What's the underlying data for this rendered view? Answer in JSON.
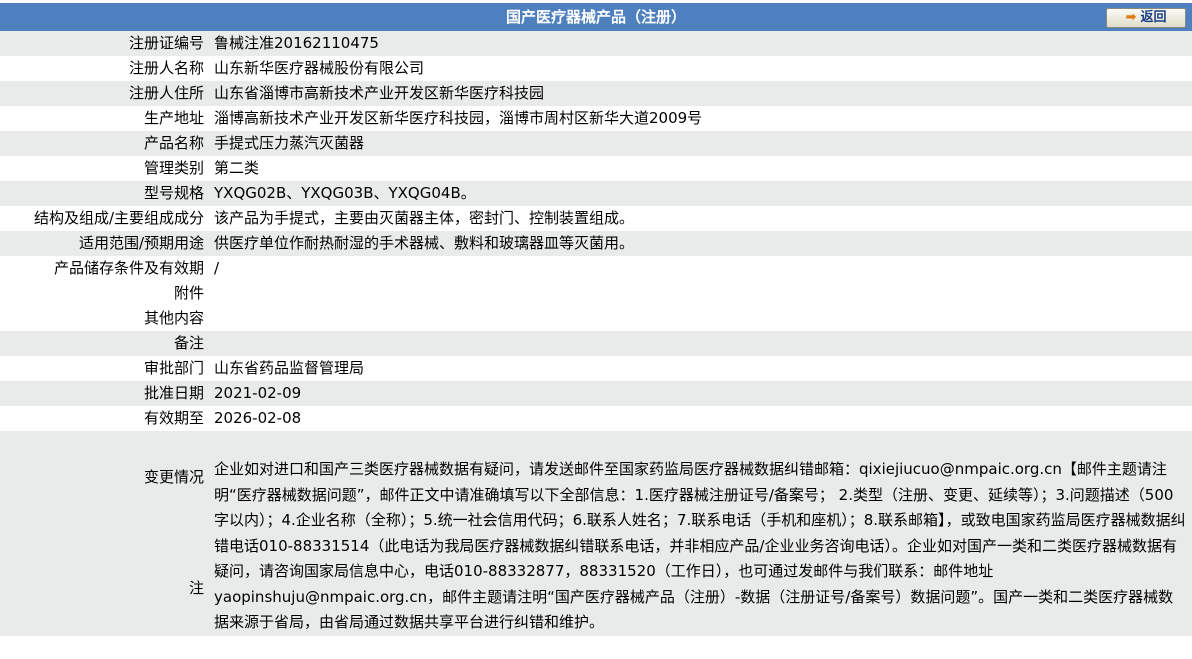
{
  "page": {
    "title": "国产医疗器械产品（注册）",
    "back_button_label": "返回",
    "back_icon": "arrow-right-icon"
  },
  "rows": [
    {
      "label": "注册证编号",
      "value": "鲁械注准20162110475"
    },
    {
      "label": "注册人名称",
      "value": "山东新华医疗器械股份有限公司"
    },
    {
      "label": "注册人住所",
      "value": "山东省淄博市高新技术产业开发区新华医疗科技园"
    },
    {
      "label": "生产地址",
      "value": "淄博高新技术产业开发区新华医疗科技园，淄博市周村区新华大道2009号"
    },
    {
      "label": "产品名称",
      "value": "手提式压力蒸汽灭菌器"
    },
    {
      "label": "管理类别",
      "value": "第二类"
    },
    {
      "label": "型号规格",
      "value": "YXQG02B、YXQG03B、YXQG04B。"
    },
    {
      "label": "结构及组成/主要组成成分",
      "value": "该产品为手提式，主要由灭菌器主体，密封门、控制装置组成。"
    },
    {
      "label": "适用范围/预期用途",
      "value": "供医疗单位作耐热耐湿的手术器械、敷料和玻璃器皿等灭菌用。"
    },
    {
      "label": "产品储存条件及有效期",
      "value": "/"
    },
    {
      "label": "附件",
      "value": ""
    },
    {
      "label": "其他内容",
      "value": ""
    },
    {
      "label": "备注",
      "value": ""
    },
    {
      "label": "审批部门",
      "value": "山东省药品监督管理局"
    },
    {
      "label": "批准日期",
      "value": "2021-02-09"
    },
    {
      "label": "有效期至",
      "value": "2026-02-08"
    },
    {
      "label": "变更情况",
      "value": ""
    }
  ],
  "note": {
    "label": "注",
    "text": "企业如对进口和国产三类医疗器械数据有疑问，请发送邮件至国家药监局医疗器械数据纠错邮箱：qixiejiucuo@nmpaic.org.cn【邮件主题请注明“医疗器械数据问题”，邮件正文中请准确填写以下全部信息：1.医疗器械注册证号/备案号； 2.类型（注册、变更、延续等）；3.问题描述（500字以内）；4.企业名称（全称）；5.统一社会信用代码；6.联系人姓名；7.联系电话（手机和座机）；8.联系邮箱】，或致电国家药监局医疗器械数据纠错电话010-88331514（此电话为我局医疗器械数据纠错联系电话，并非相应产品/企业业务咨询电话）。企业如对国产一类和二类医疗器械数据有疑问，请咨询国家局信息中心，电话010-88332877，88331520（工作日），也可通过发邮件与我们联系：邮件地址yaopinshuju@nmpaic.org.cn，邮件主题请注明“国产医疗器械产品（注册）-数据（注册证号/备案号）数据问题”。国产一类和二类医疗器械数据来源于省局，由省局通过数据共享平台进行纠错和维护。"
  },
  "colors": {
    "header_bg": "#4e7fbf",
    "row_alt_bg": "#e9ebea"
  }
}
